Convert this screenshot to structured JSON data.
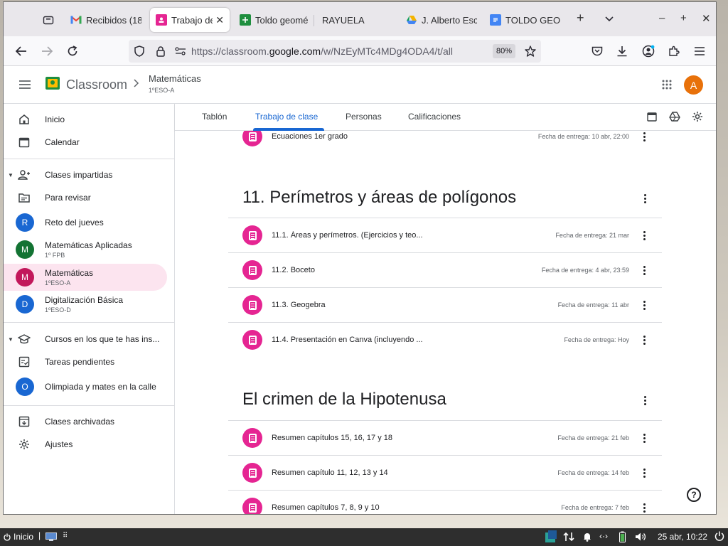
{
  "browser": {
    "tabs": [
      {
        "label": "Recibidos (18",
        "icon": "gmail-icon"
      },
      {
        "label": "Trabajo de",
        "icon": "classroom-icon",
        "active": true
      },
      {
        "label": "Toldo geomé",
        "icon": "sheets-icon"
      },
      {
        "label": "RAYUELA",
        "icon": ""
      },
      {
        "label": "J. Alberto Esc",
        "icon": "drive-icon"
      },
      {
        "label": "TOLDO GEOM",
        "icon": "docs-icon"
      }
    ],
    "url_prefix": "https://classroom.",
    "url_domain": "google.com",
    "url_path": "/w/NzEyMTc4MDg4ODA4/t/all",
    "zoom": "80%"
  },
  "header": {
    "brand": "Classroom",
    "course": "Matemáticas",
    "section": "1ºESO-A",
    "avatar_letter": "A"
  },
  "sidebar": {
    "items": [
      {
        "label": "Inicio"
      },
      {
        "label": "Calendar"
      },
      {
        "label": "Clases impartidas"
      },
      {
        "label": "Para revisar"
      },
      {
        "label": "Reto del jueves",
        "letter": "R",
        "color": "#1967d2"
      },
      {
        "label": "Matemáticas Aplicadas",
        "sub": "1º FPB",
        "letter": "M",
        "color": "#137333"
      },
      {
        "label": "Matemáticas",
        "sub": "1ºESO-A",
        "letter": "M",
        "color": "#c2185b"
      },
      {
        "label": "Digitalización Básica",
        "sub": "1ºESO-D",
        "letter": "D",
        "color": "#1967d2"
      },
      {
        "label": "Cursos en los que te has ins..."
      },
      {
        "label": "Tareas pendientes"
      },
      {
        "label": "Olimpiada y mates en la calle",
        "letter": "O",
        "color": "#1967d2"
      },
      {
        "label": "Clases archivadas"
      },
      {
        "label": "Ajustes"
      }
    ]
  },
  "main_tabs": [
    "Tablón",
    "Trabajo de clase",
    "Personas",
    "Calificaciones"
  ],
  "content": {
    "top_row": {
      "title": "Ecuaciones 1er grado",
      "due": "Fecha de entrega: 10 abr, 22:00"
    },
    "topics": [
      {
        "title": "11. Perímetros y áreas de polígonos",
        "assignments": [
          {
            "title": "11.1. Áreas y perímetros. (Ejercicios y teo...",
            "due": "Fecha de entrega: 21 mar"
          },
          {
            "title": "11.2. Boceto",
            "due": "Fecha de entrega: 4 abr, 23:59"
          },
          {
            "title": "11.3. Geogebra",
            "due": "Fecha de entrega: 11 abr"
          },
          {
            "title": "11.4. Presentación en Canva (incluyendo ...",
            "due": "Fecha de entrega: Hoy"
          }
        ]
      },
      {
        "title": "El crimen de la Hipotenusa",
        "assignments": [
          {
            "title": "Resumen capítulos 15, 16, 17 y 18",
            "due": "Fecha de entrega: 21 feb"
          },
          {
            "title": "Resumen capítulo 11, 12, 13 y 14",
            "due": "Fecha de entrega: 14 feb"
          },
          {
            "title": "Resumen capítulos 7, 8, 9 y 10",
            "due": "Fecha de entrega: 7 feb"
          }
        ]
      }
    ]
  },
  "taskbar": {
    "start_label": "Inicio",
    "clock": "25 abr, 10:22"
  }
}
